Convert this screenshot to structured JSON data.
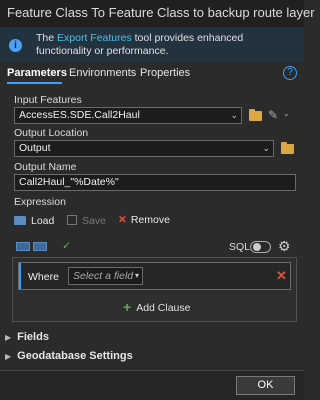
{
  "window": {
    "title": "Feature Class To Feature Class to backup route layer"
  },
  "info_bar": {
    "text_before": "The ",
    "link_text": "Export Features",
    "text_after": " tool provides enhanced functionality or performance."
  },
  "tabs": [
    {
      "label": "Parameters",
      "active": true
    },
    {
      "label": "Environments",
      "active": false
    },
    {
      "label": "Properties",
      "active": false
    }
  ],
  "help_glyph": "?",
  "fields": {
    "input_features": {
      "label": "Input Features",
      "value": "AccessES.SDE.Call2Haul"
    },
    "output_location": {
      "label": "Output Location",
      "value": "Output"
    },
    "output_name": {
      "label": "Output Name",
      "value": "Call2Haul_\"%Date%\""
    }
  },
  "expression": {
    "label": "Expression",
    "load_label": "Load",
    "save_label": "Save",
    "remove_label": "Remove",
    "sql_label": "SQL",
    "sql_toggle_on": false,
    "where_label": "Where",
    "select_field_placeholder": "Select a field",
    "add_clause_label": "Add Clause"
  },
  "sections": {
    "fields_label": "Fields",
    "geodatabase_label": "Geodatabase Settings"
  },
  "footer": {
    "ok_label": "OK"
  },
  "colors": {
    "accent": "#3aa0ff",
    "link": "#4ec0e4",
    "add": "#56b24a",
    "remove": "#e0533c",
    "folder": "#d9a845"
  },
  "icons": {
    "info": "info-icon",
    "help": "help-icon",
    "folder": "folder-icon",
    "pencil": "pencil-icon",
    "load": "folder-open-icon",
    "save": "save-icon",
    "remove": "close-icon",
    "gear": "gear-icon",
    "check": "check-icon",
    "add": "plus-icon"
  }
}
